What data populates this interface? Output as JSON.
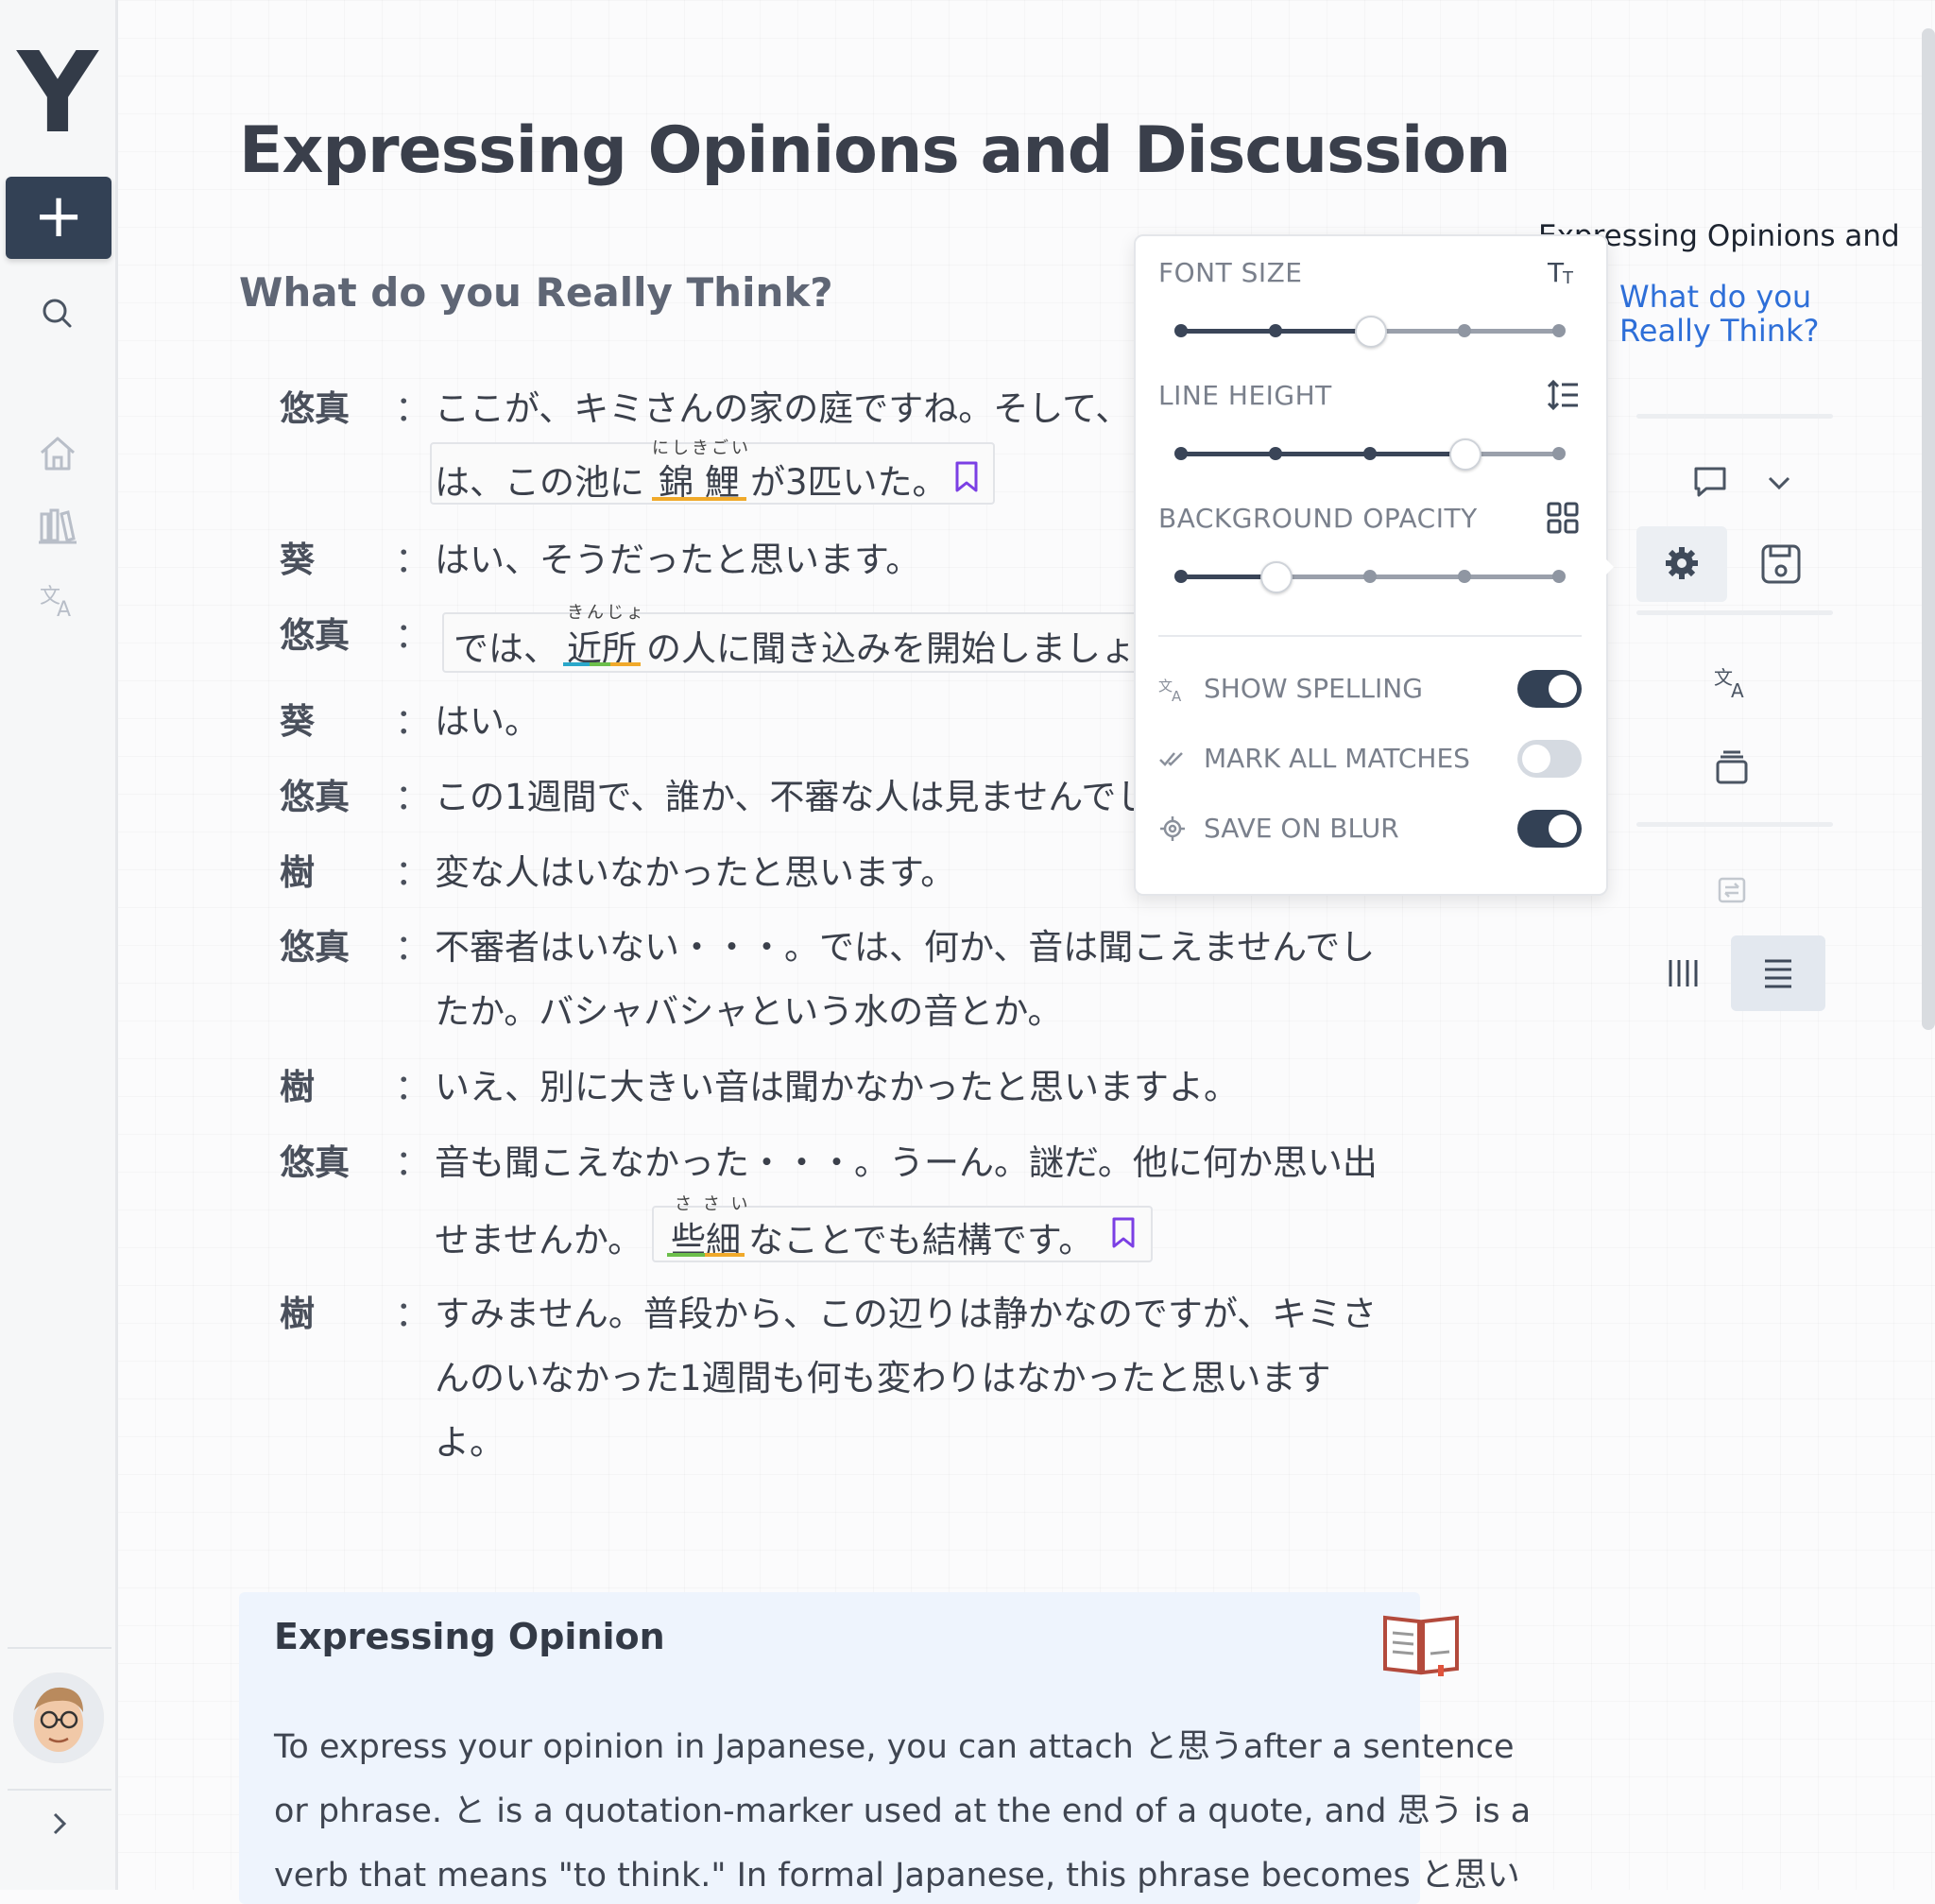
{
  "sidebar": {
    "logo": "Y",
    "new_label": "+",
    "icons": [
      "search-icon",
      "home-icon",
      "library-icon",
      "translate-icon"
    ]
  },
  "main": {
    "title": "Expressing Opinions and Discussion",
    "subtitle": "What do you Really Think?",
    "dialogue": [
      {
        "speaker": "悠真",
        "colon": "：",
        "lines": [
          "ここが、キミさんの家の庭ですね。そして、",
          "は、この池に",
          "が3匹いた。"
        ],
        "highlight": "錦 鯉",
        "furigana": "にしきごい"
      },
      {
        "speaker": "葵",
        "colon": "：",
        "lines": [
          "はい、そうだったと思います。"
        ]
      },
      {
        "speaker": "悠真",
        "colon": "：",
        "lines": [
          "では、",
          "の人に聞き込みを開始しましょ"
        ],
        "highlight": "近所",
        "furigana": "きんじょ"
      },
      {
        "speaker": "葵",
        "colon": "：",
        "lines": [
          "はい。"
        ]
      },
      {
        "speaker": "悠真",
        "colon": "：",
        "lines": [
          "この1週間で、誰か、不審な人は見ませんでし"
        ]
      },
      {
        "speaker": "樹",
        "colon": "：",
        "lines": [
          "変な人はいなかったと思います。"
        ]
      },
      {
        "speaker": "悠真",
        "colon": "：",
        "lines": [
          "不審者はいない・・・。では、何か、音は聞こえませんでし",
          "たか。バシャバシャという水の音とか。"
        ]
      },
      {
        "speaker": "樹",
        "colon": "：",
        "lines": [
          "いえ、別に大きい音は聞かなかったと思いますよ。"
        ]
      },
      {
        "speaker": "悠真",
        "colon": "：",
        "lines": [
          "音も聞こえなかった・・・。うーん。謎だ。他に何か思い出",
          "せませんか。",
          "なことでも結構です。"
        ],
        "highlight": "些細",
        "furigana": "さ さ い"
      },
      {
        "speaker": "樹",
        "colon": "：",
        "lines": [
          "すみません。普段から、この辺りは静かなのですが、キミさ",
          "んのいなかった1週間も何も変わりはなかったと思います",
          "よ。"
        ]
      }
    ]
  },
  "note": {
    "title": "Expressing Opinion",
    "lines": [
      "To express your opinion in Japanese, you can attach と思うafter a sentence",
      "or phrase. と is a quotation-marker used at the end of a quote, and 思う is a",
      "verb that means \"to think.\" In formal Japanese, this phrase becomes と思い"
    ]
  },
  "outline": {
    "title": "Expressing Opinions and",
    "link": "What do you Really Think?"
  },
  "settings": {
    "font_size": {
      "label": "FONT SIZE",
      "level": 3,
      "steps": 5
    },
    "line_height": {
      "label": "LINE HEIGHT",
      "level": 4,
      "steps": 5
    },
    "bg_opacity": {
      "label": "BACKGROUND OPACITY",
      "level": 2,
      "steps": 5
    },
    "toggles": [
      {
        "label": "SHOW SPELLING",
        "on": true,
        "icon": "translate-icon"
      },
      {
        "label": "MARK ALL MATCHES",
        "on": false,
        "icon": "check-all-icon"
      },
      {
        "label": "SAVE ON BLUR",
        "on": true,
        "icon": "gear-icon"
      }
    ]
  },
  "colors": {
    "accent": "#334155",
    "link": "#2e6fd8",
    "bookmark": "#7b3fe4",
    "underline_orange": "#f0a92a",
    "underline_green": "#6cbf4a",
    "underline_blue": "#2aa7c9",
    "card_bg": "#eef4fd"
  }
}
